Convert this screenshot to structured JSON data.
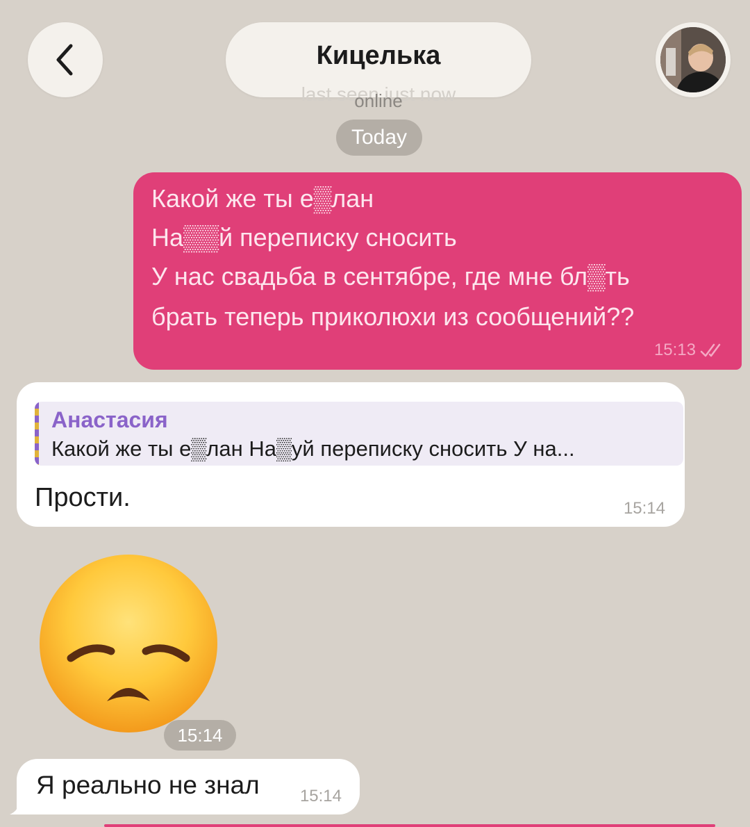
{
  "header": {
    "back_icon": "chevron-left-icon",
    "contact_name": "Кицелька",
    "status_ghost": "last seen just now",
    "status": "online",
    "avatar_icon": "contact-avatar"
  },
  "date_separator": "Today",
  "messages": [
    {
      "direction": "outgoing",
      "lines": [
        "Какой же ты е▒лан",
        "На▒▒й переписку сносить",
        "У нас свадьба в сентябре, где мне бл▒ть",
        "брать теперь приколюхи из сообщений??"
      ],
      "time": "15:13",
      "read_icon": "double-check-icon"
    },
    {
      "direction": "incoming",
      "reply": {
        "author": "Анастасия",
        "text": "Какой же ты е▒лан На▒уй переписку сносить У на..."
      },
      "text": "Прости.",
      "time": "15:14"
    },
    {
      "direction": "incoming",
      "type": "emoji",
      "emoji_icon": "disappointed-face-icon",
      "time": "15:14"
    },
    {
      "direction": "incoming",
      "text": "Я реально не знал",
      "time": "15:14"
    }
  ],
  "colors": {
    "background": "#d7d1c9",
    "outgoing_bubble": "#e03f78",
    "incoming_bubble": "#ffffff",
    "reply_accent": "#8a63c9",
    "badge": "#b4aea6"
  }
}
